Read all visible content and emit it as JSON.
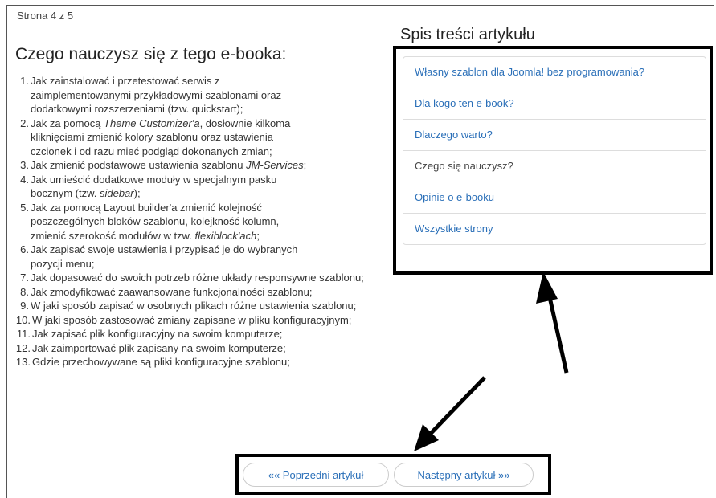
{
  "page_indicator": "Strona 4 z 5",
  "main": {
    "heading": "Czego nauczysz się z tego e-booka:",
    "items": [
      {
        "num": "1.",
        "lines": [
          "Jak zainstalować i przetestować serwis z",
          "zaimplementowanymi przykładowymi szablonami oraz",
          "dodatkowymi rozszerzeniami (tzw. quickstart);"
        ]
      },
      {
        "num": "2.",
        "pre": "Jak za pomocą ",
        "em": "Theme Customizer'a",
        "post": ", dosłownie kilkoma",
        "lines": [
          "kliknięciami zmienić kolory szablonu oraz ustawienia",
          "czcionek i od razu mieć podgląd dokonanych zmian;"
        ]
      },
      {
        "num": "3.",
        "pre": "Jak zmienić podstawowe ustawienia szablonu ",
        "em": "JM-Services",
        "post": ";"
      },
      {
        "num": "4.",
        "line1": "Jak umieścić dodatkowe moduły w specjalnym pasku",
        "pre": "bocznym (tzw. ",
        "em": "sidebar",
        "post": ");"
      },
      {
        "num": "5.",
        "lines": [
          "Jak za pomocą Layout builder'a zmienić kolejność",
          "poszczególnych bloków szablonu, kolejkność kolumn,"
        ],
        "pre": "zmienić szerokość modułów w tzw. ",
        "em": "flexiblock'ach",
        "post": ";"
      },
      {
        "num": "6.",
        "lines": [
          "Jak zapisać swoje ustawienia i przypisać je do wybranych",
          "pozycji menu;"
        ]
      },
      {
        "num": "7.",
        "text": "Jak dopasować do swoich potrzeb różne układy responsywne szablonu;"
      },
      {
        "num": "8.",
        "text": "Jak zmodyfikować zaawansowane funkcjonalności szablonu;"
      },
      {
        "num": "9.",
        "text": "W jaki sposób zapisać w osobnych plikach różne ustawienia szablonu;"
      },
      {
        "num": "10.",
        "text": "W jaki sposób zastosować zmiany zapisane w pliku konfiguracyjnym;"
      },
      {
        "num": "11.",
        "text": "Jak zapisać plik konfiguracyjny na swoim komputerze;"
      },
      {
        "num": "12.",
        "text": "Jak zaimportować plik zapisany na swoim komputerze;"
      },
      {
        "num": "13.",
        "text": "Gdzie przechowywane są pliki konfiguracyjne szablonu;"
      }
    ]
  },
  "toc": {
    "title": "Spis treści artykułu",
    "items": [
      {
        "label": "Własny szablon dla Joomla! bez programowania?"
      },
      {
        "label": "Dla kogo ten e-book?"
      },
      {
        "label": "Dlaczego warto?"
      },
      {
        "label": "Czego się nauczysz?"
      },
      {
        "label": "Opinie o e-booku"
      },
      {
        "label": "Wszystkie strony"
      }
    ]
  },
  "pager": {
    "prev_label": "«« Poprzedni artykuł",
    "next_label": "Następny artykuł »»"
  },
  "colors": {
    "link": "#2a6fb8",
    "highlight": "#000000"
  }
}
